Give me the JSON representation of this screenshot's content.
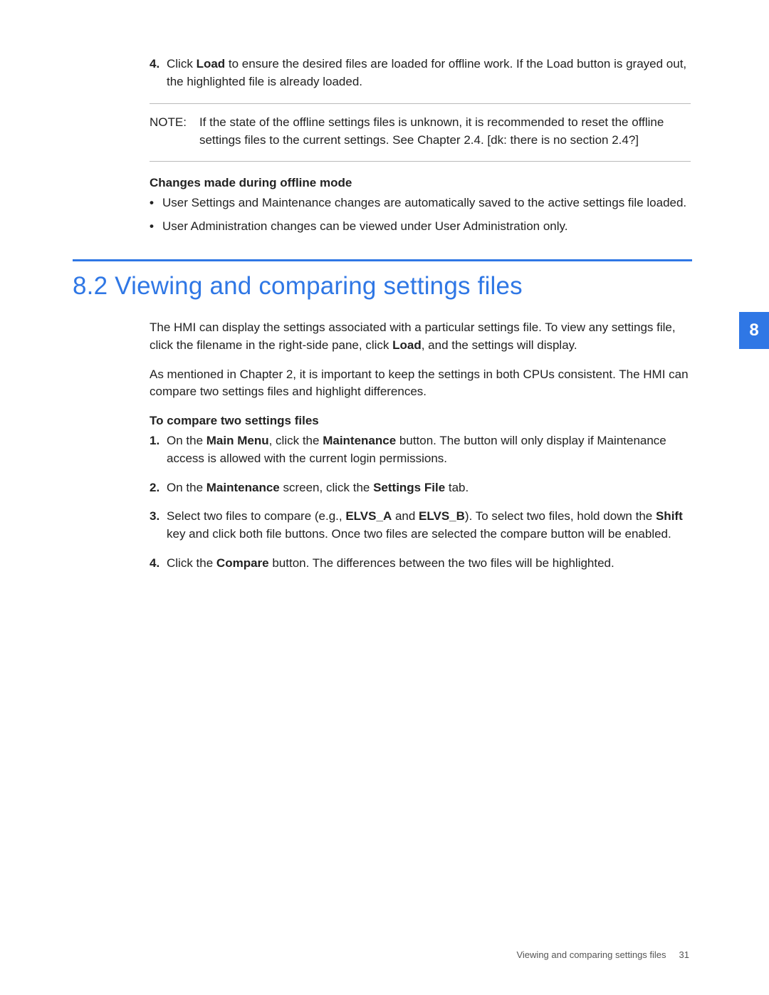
{
  "top_list": {
    "num": "4.",
    "pre": "Click ",
    "bold1": "Load",
    "post": " to ensure the desired files are loaded for offline work. If the Load button is grayed out, the highlighted file is already loaded."
  },
  "note": {
    "label": "NOTE:",
    "text": "If the state of the offline settings files is unknown, it is recommended to reset the offline settings files to the current settings. See Chapter 2.4. [dk: there is no section 2.4?]"
  },
  "changes": {
    "heading": "Changes made during offline mode",
    "items": [
      "User Settings and Maintenance changes are automatically saved to the active settings file loaded.",
      "User Administration changes can be viewed under User Administration only."
    ]
  },
  "section": {
    "number_title": "8.2 Viewing and comparing settings files"
  },
  "intro": {
    "p1_a": "The HMI can display the settings associated with a particular settings file. To view any settings file, click the filename in the right-side pane, click ",
    "p1_bold": "Load",
    "p1_b": ", and the settings will display.",
    "p2": "As mentioned in Chapter 2, it is important to keep the settings in both CPUs consistent. The HMI can compare two settings files and highlight differences."
  },
  "compare": {
    "heading": "To compare two settings files",
    "items": [
      {
        "num": "1.",
        "a": "On the ",
        "b1": "Main Menu",
        "b": ", click the ",
        "b2": "Maintenance",
        "c": " button. The button will only display if Maintenance access is allowed with the current login permissions."
      },
      {
        "num": "2.",
        "a": "On the ",
        "b1": "Maintenance",
        "b": " screen, click the ",
        "b2": "Settings File",
        "c": " tab."
      },
      {
        "num": "3.",
        "a": "Select two files to compare (e.g., ",
        "b1": "ELVS_A",
        "b": " and ",
        "b2": "ELVS_B",
        "c": "). To select two files, hold down the ",
        "b3": "Shift",
        "d": " key and click both file buttons. Once two files are selected the compare button will be enabled."
      },
      {
        "num": "4.",
        "a": "Click the ",
        "b1": "Compare",
        "b": " button. The differences between the two files will be highlighted.",
        "b2": "",
        "c": ""
      }
    ]
  },
  "tab": "8",
  "footer": {
    "title": "Viewing and comparing settings files",
    "page": "31"
  }
}
